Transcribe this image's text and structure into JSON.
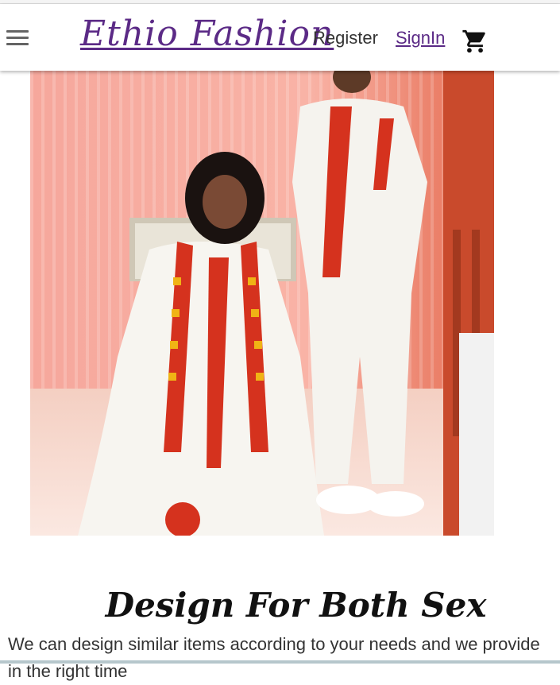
{
  "header": {
    "brand": "Ethio Fashion",
    "nav": {
      "register": "Register",
      "signin": "SignIn"
    },
    "icons": {
      "menu": "hamburger-menu-icon",
      "cart": "shopping-cart-icon"
    }
  },
  "hero": {
    "image_description": "couple in white traditional Ethiopian dress with red embroidered borders"
  },
  "section": {
    "heading": "Design For Both Sex",
    "description": "We can design similar items according to your needs and we provide in the right time"
  },
  "colors": {
    "brand": "#5b2a86",
    "text": "#333333"
  }
}
